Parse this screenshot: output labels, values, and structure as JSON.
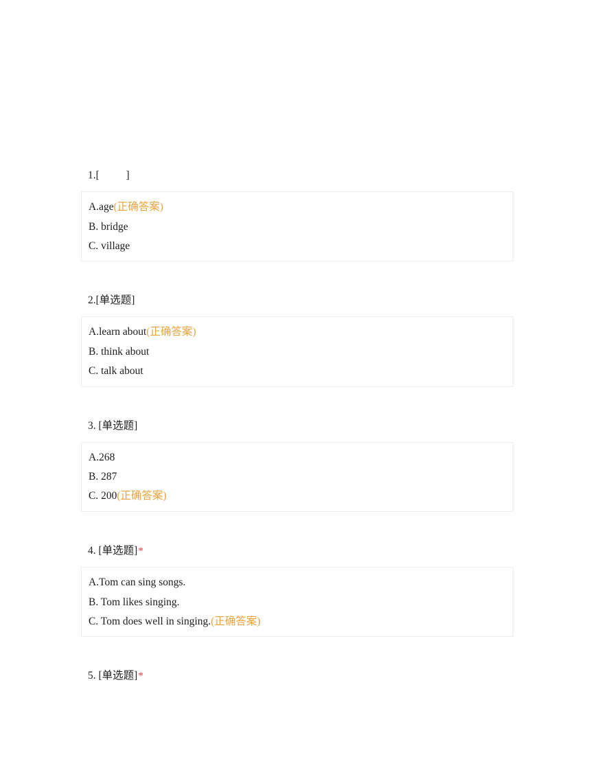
{
  "document": {
    "type": "quiz-answer-sheet",
    "correct_answer_label": "(正确答案)",
    "required_marker": "*",
    "colors": {
      "correct_answer": "#e8a33d",
      "required_marker": "#e8393c",
      "box_border": "#ececec",
      "text": "#1a1a1a",
      "page_background": "#ffffff"
    }
  },
  "questions": [
    {
      "index": "1.",
      "type": "[          ]",
      "required": "",
      "options": [
        {
          "label": "A.age",
          "answer_tag": "(正确答案)"
        },
        {
          "label": "B. bridge",
          "answer_tag": ""
        },
        {
          "label": "C. village",
          "answer_tag": ""
        }
      ]
    },
    {
      "index": "2.",
      "type": "[单选题]",
      "required": "",
      "options": [
        {
          "label": "A.learn about",
          "answer_tag": "(正确答案)"
        },
        {
          "label": "B. think about",
          "answer_tag": ""
        },
        {
          "label": "C. talk about",
          "answer_tag": ""
        }
      ]
    },
    {
      "index": "3.",
      "type": " [单选题]",
      "required": "",
      "options": [
        {
          "label": "A.268",
          "answer_tag": ""
        },
        {
          "label": "B. 287",
          "answer_tag": ""
        },
        {
          "label": "C. 200",
          "answer_tag": "(正确答案)"
        }
      ]
    },
    {
      "index": "4.",
      "type": " [单选题]",
      "required": "*",
      "options": [
        {
          "label": "A.Tom can sing songs.",
          "answer_tag": ""
        },
        {
          "label": "B. Tom likes singing.",
          "answer_tag": ""
        },
        {
          "label": "C. Tom does well in singing.",
          "answer_tag": "(正确答案)"
        }
      ]
    },
    {
      "index": "5.",
      "type": " [单选题]",
      "required": "*",
      "options": []
    }
  ]
}
